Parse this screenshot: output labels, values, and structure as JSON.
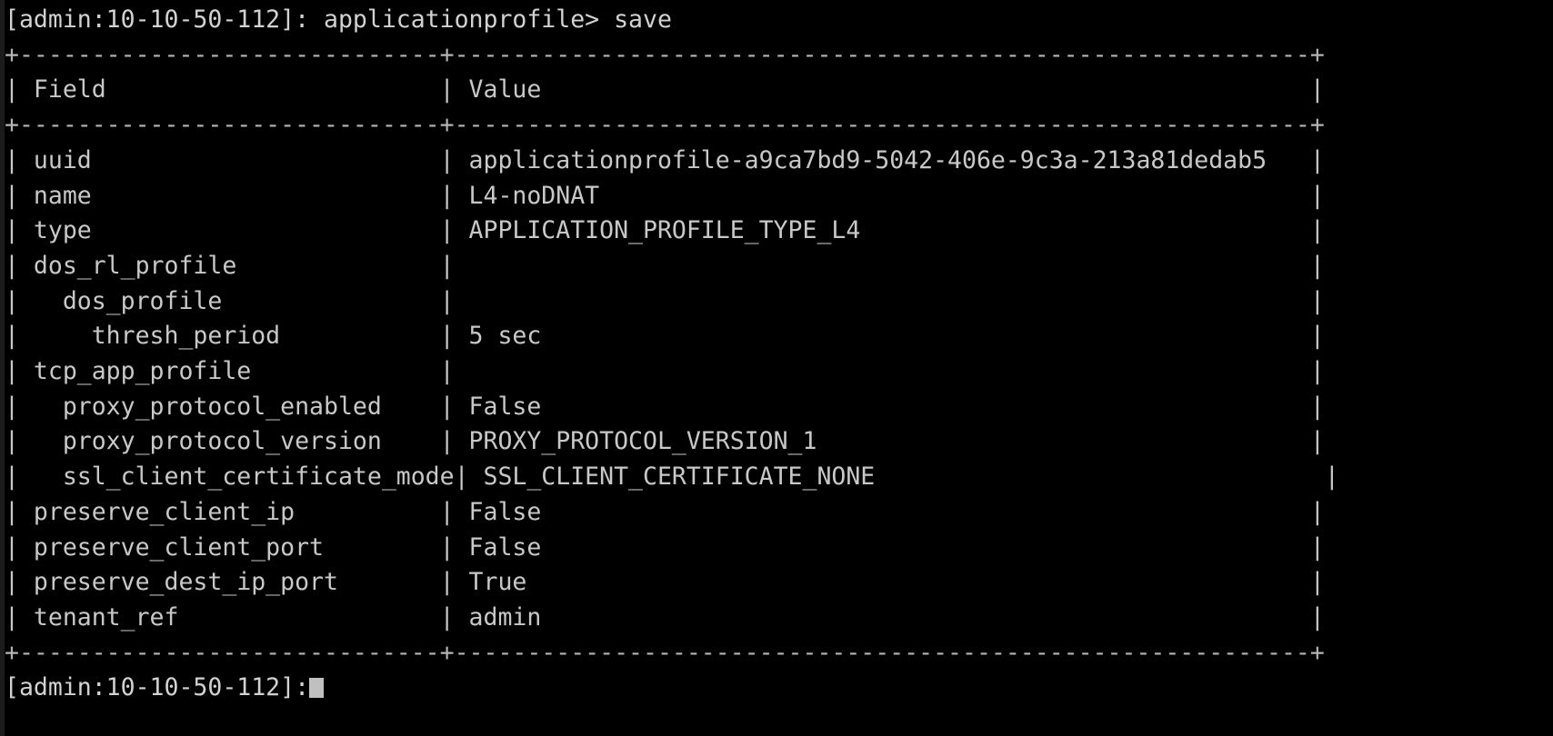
{
  "terminal": {
    "background_color": "#000000",
    "foreground_color": "#c8c8c8",
    "cursor_color": "#c0c0c0",
    "prompt_line": "[admin:10-10-50-112]: applicationprofile> save",
    "prompt_text": "[admin:10-10-50-112]: applicationprofile>",
    "command": "save",
    "bottom_prompt_line": "[admin:10-10-50-112]:",
    "cursor_glyph": "block-cursor"
  },
  "table": {
    "border_top": "+-----------------------------+-----------------------------------------------------------+",
    "border_header": "+-----------------------------+-----------------------------------------------------------+",
    "border_bottom": "+-----------------------------+-----------------------------------------------------------+",
    "headers": [
      "Field",
      "Value"
    ],
    "header_row": "| Field                       | Value                                                     |",
    "field_column_width": 29,
    "value_column_width": 59,
    "rows": [
      {
        "field": "uuid",
        "indent": 0,
        "value": "applicationprofile-a9ca7bd9-5042-406e-9c3a-213a81dedab5"
      },
      {
        "field": "name",
        "indent": 0,
        "value": "L4-noDNAT"
      },
      {
        "field": "type",
        "indent": 0,
        "value": "APPLICATION_PROFILE_TYPE_L4"
      },
      {
        "field": "dos_rl_profile",
        "indent": 0,
        "value": ""
      },
      {
        "field": "dos_profile",
        "indent": 2,
        "value": ""
      },
      {
        "field": "thresh_period",
        "indent": 4,
        "value": "5 sec"
      },
      {
        "field": "tcp_app_profile",
        "indent": 0,
        "value": ""
      },
      {
        "field": "proxy_protocol_enabled",
        "indent": 2,
        "value": "False"
      },
      {
        "field": "proxy_protocol_version",
        "indent": 2,
        "value": "PROXY_PROTOCOL_VERSION_1"
      },
      {
        "field": "ssl_client_certificate_mode",
        "indent": 2,
        "value": "SSL_CLIENT_CERTIFICATE_NONE"
      },
      {
        "field": "preserve_client_ip",
        "indent": 0,
        "value": "False"
      },
      {
        "field": "preserve_client_port",
        "indent": 0,
        "value": "False"
      },
      {
        "field": "preserve_dest_ip_port",
        "indent": 0,
        "value": "True"
      },
      {
        "field": "tenant_ref",
        "indent": 0,
        "value": "admin"
      }
    ]
  }
}
